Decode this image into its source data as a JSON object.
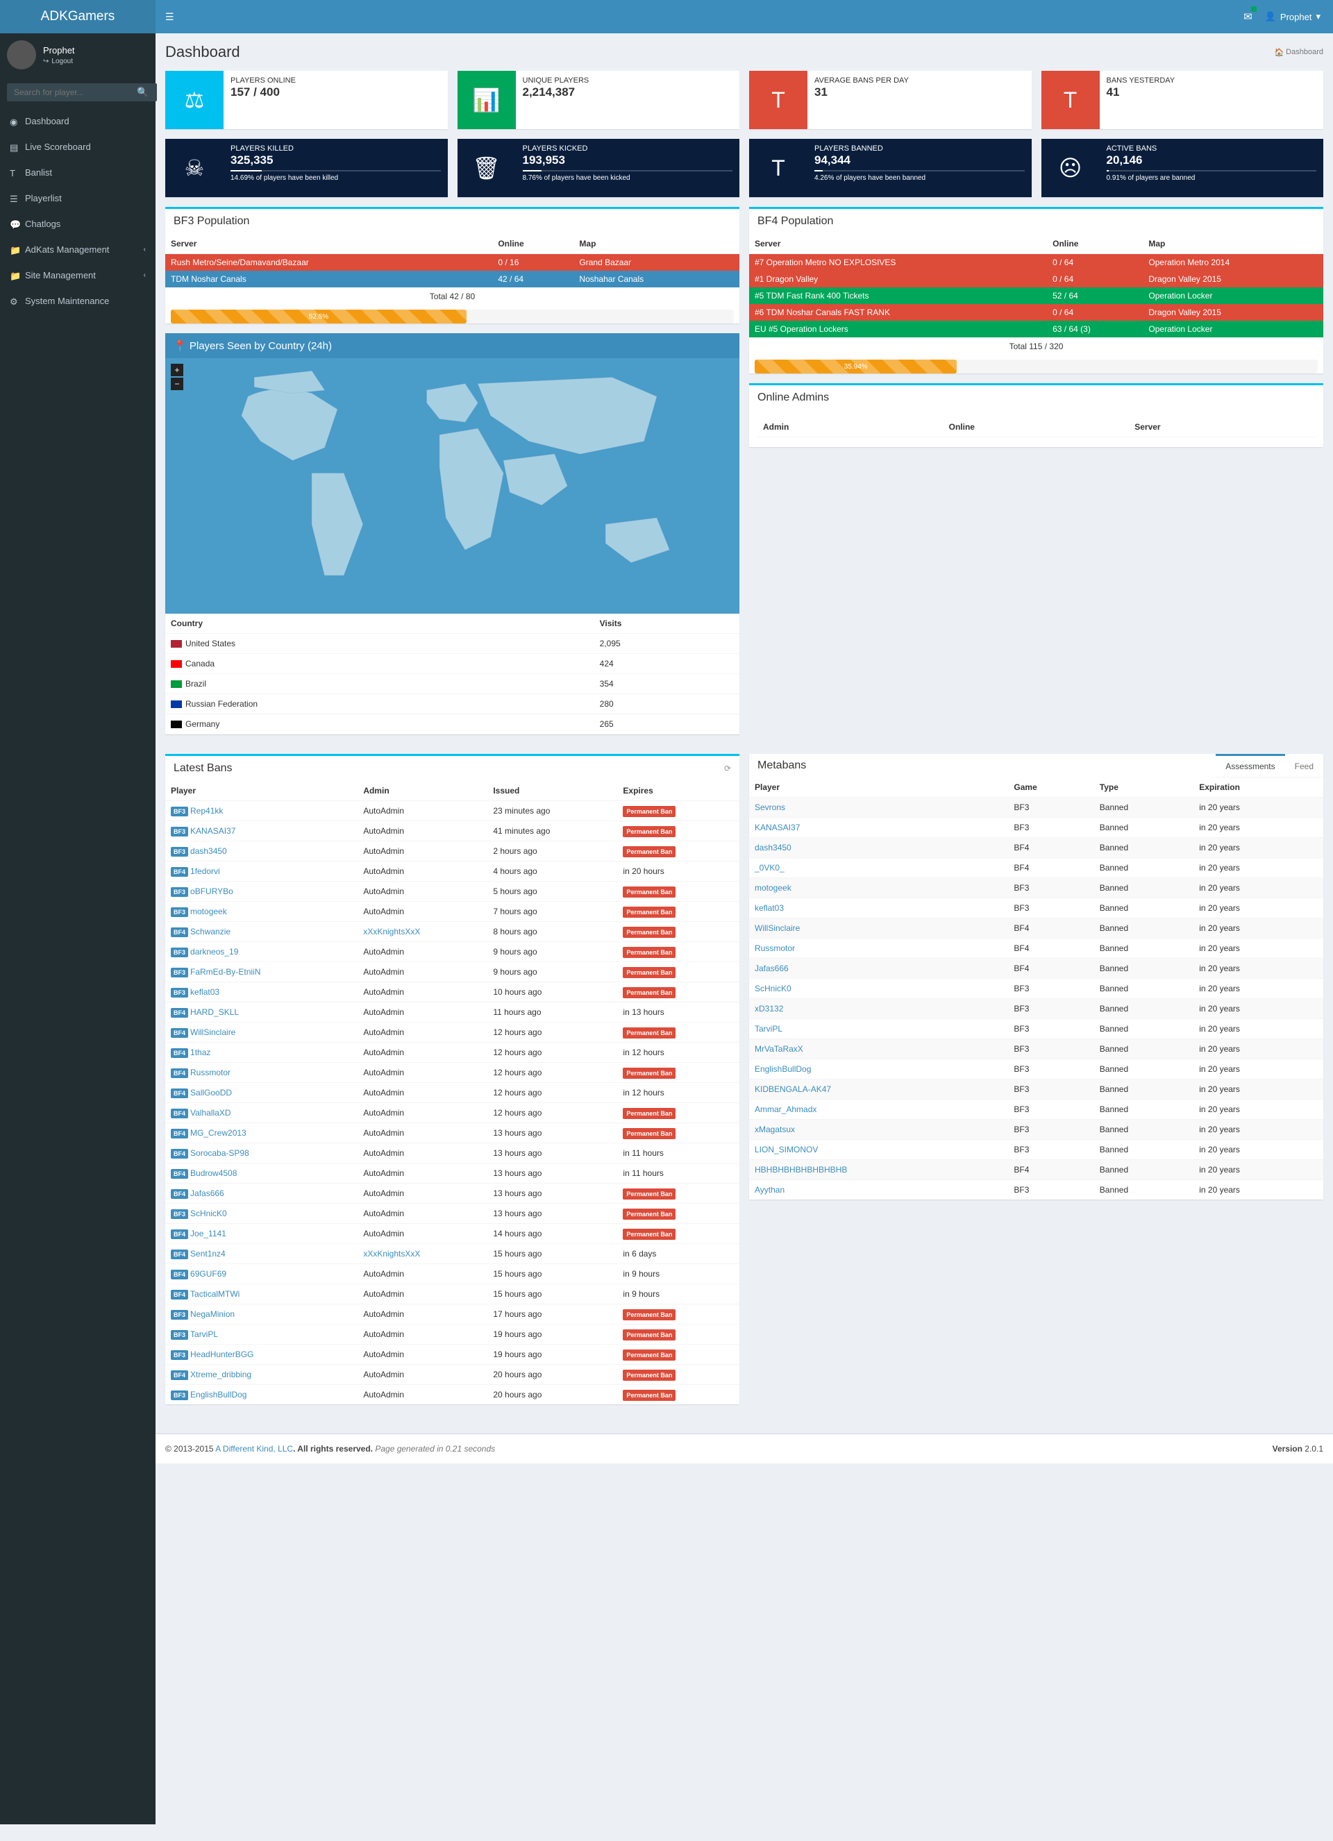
{
  "brand": "ADKGamers",
  "user": {
    "name": "Prophet",
    "logout": "Logout"
  },
  "search_placeholder": "Search for player...",
  "sidebar": [
    {
      "icon": "dashboard",
      "label": "Dashboard"
    },
    {
      "icon": "scoreboard",
      "label": "Live Scoreboard"
    },
    {
      "icon": "banlist",
      "label": "Banlist"
    },
    {
      "icon": "playerlist",
      "label": "Playerlist"
    },
    {
      "icon": "chat",
      "label": "Chatlogs"
    },
    {
      "icon": "folder",
      "label": "AdKats Management",
      "sub": true
    },
    {
      "icon": "folder",
      "label": "Site Management",
      "sub": true
    },
    {
      "icon": "cogs",
      "label": "System Maintenance"
    }
  ],
  "page_title": "Dashboard",
  "breadcrumb": "Dashboard",
  "stats_top": [
    {
      "bg": "aqua",
      "title": "PLAYERS ONLINE",
      "value": "157 / 400"
    },
    {
      "bg": "green",
      "title": "UNIQUE PLAYERS",
      "value": "2,214,387"
    },
    {
      "bg": "red",
      "title": "AVERAGE BANS PER DAY",
      "value": "31"
    },
    {
      "bg": "red",
      "title": "BANS YESTERDAY",
      "value": "41"
    }
  ],
  "stats_dark": [
    {
      "title": "PLAYERS KILLED",
      "value": "325,335",
      "desc": "14.69% of players have been killed",
      "pct": 15
    },
    {
      "title": "PLAYERS KICKED",
      "value": "193,953",
      "desc": "8.76% of players have been kicked",
      "pct": 9
    },
    {
      "title": "PLAYERS BANNED",
      "value": "94,344",
      "desc": "4.26% of players have been banned",
      "pct": 4
    },
    {
      "title": "ACTIVE BANS",
      "value": "20,146",
      "desc": "0.91% of players are banned",
      "pct": 1
    }
  ],
  "bf3": {
    "title": "BF3 Population",
    "headers": [
      "Server",
      "Online",
      "Map"
    ],
    "rows": [
      {
        "c": "red",
        "name": "Rush Metro/Seine/Damavand/Bazaar",
        "online": "0 / 16",
        "map": "Grand Bazaar"
      },
      {
        "c": "blue",
        "name": "TDM Noshar Canals",
        "online": "42 / 64",
        "map": "Noshahar Canals"
      }
    ],
    "total": "Total   42 / 80",
    "bar_pct": 52.5,
    "bar_label": "52.5%"
  },
  "bf4": {
    "title": "BF4 Population",
    "headers": [
      "Server",
      "Online",
      "Map"
    ],
    "rows": [
      {
        "c": "red",
        "name": "#7 Operation Metro NO EXPLOSIVES",
        "online": "0 / 64",
        "map": "Operation Metro 2014"
      },
      {
        "c": "red",
        "name": "#1 Dragon Valley",
        "online": "0 / 64",
        "map": "Dragon Valley 2015"
      },
      {
        "c": "green",
        "name": "#5 TDM Fast Rank 400 Tickets",
        "online": "52 / 64",
        "map": "Operation Locker"
      },
      {
        "c": "red",
        "name": "#6 TDM Noshar Canals FAST RANK",
        "online": "0 / 64",
        "map": "Dragon Valley 2015"
      },
      {
        "c": "green",
        "name": "EU #5 Operation Lockers",
        "online": "63 / 64 (3)",
        "map": "Operation Locker"
      }
    ],
    "total": "Total   115 / 320",
    "bar_pct": 35.94,
    "bar_label": "35.94%"
  },
  "map_title": "Players Seen by Country (24h)",
  "country_headers": [
    "Country",
    "Visits"
  ],
  "countries": [
    {
      "flag": "#b22234",
      "name": "United States",
      "visits": "2,095"
    },
    {
      "flag": "#ff0000",
      "name": "Canada",
      "visits": "424"
    },
    {
      "flag": "#009b3a",
      "name": "Brazil",
      "visits": "354"
    },
    {
      "flag": "#0039a6",
      "name": "Russian Federation",
      "visits": "280"
    },
    {
      "flag": "#000000",
      "name": "Germany",
      "visits": "265"
    }
  ],
  "online_admins": {
    "title": "Online Admins",
    "headers": [
      "Admin",
      "Online",
      "Server"
    ]
  },
  "latest_bans": {
    "title": "Latest Bans",
    "headers": [
      "Player",
      "Admin",
      "Issued",
      "Expires"
    ],
    "perm_label": "Permanent Ban",
    "rows": [
      {
        "g": "BF3",
        "player": "Rep41kk",
        "admin": "AutoAdmin",
        "issued": "23 minutes ago",
        "expires": "perm"
      },
      {
        "g": "BF3",
        "player": "KANASAI37",
        "admin": "AutoAdmin",
        "issued": "41 minutes ago",
        "expires": "perm"
      },
      {
        "g": "BF3",
        "player": "dash3450",
        "admin": "AutoAdmin",
        "issued": "2 hours ago",
        "expires": "perm"
      },
      {
        "g": "BF4",
        "player": "1fedorvi",
        "admin": "AutoAdmin",
        "issued": "4 hours ago",
        "expires": "in 20 hours"
      },
      {
        "g": "BF3",
        "player": "oBFURYBo",
        "admin": "AutoAdmin",
        "issued": "5 hours ago",
        "expires": "perm"
      },
      {
        "g": "BF3",
        "player": "motogeek",
        "admin": "AutoAdmin",
        "issued": "7 hours ago",
        "expires": "perm"
      },
      {
        "g": "BF4",
        "player": "Schwanzie",
        "admin": "xXxKnightsXxX",
        "admin_link": true,
        "issued": "8 hours ago",
        "expires": "perm"
      },
      {
        "g": "BF3",
        "player": "darkneos_19",
        "admin": "AutoAdmin",
        "issued": "9 hours ago",
        "expires": "perm"
      },
      {
        "g": "BF3",
        "player": "FaRmEd-By-EtniiN",
        "admin": "AutoAdmin",
        "issued": "9 hours ago",
        "expires": "perm"
      },
      {
        "g": "BF3",
        "player": "keflat03",
        "admin": "AutoAdmin",
        "issued": "10 hours ago",
        "expires": "perm"
      },
      {
        "g": "BF4",
        "player": "HARD_SKLL",
        "admin": "AutoAdmin",
        "issued": "11 hours ago",
        "expires": "in 13 hours"
      },
      {
        "g": "BF4",
        "player": "WillSinclaire",
        "admin": "AutoAdmin",
        "issued": "12 hours ago",
        "expires": "perm"
      },
      {
        "g": "BF4",
        "player": "1thaz",
        "admin": "AutoAdmin",
        "issued": "12 hours ago",
        "expires": "in 12 hours"
      },
      {
        "g": "BF4",
        "player": "Russmotor",
        "admin": "AutoAdmin",
        "issued": "12 hours ago",
        "expires": "perm"
      },
      {
        "g": "BF4",
        "player": "SallGooDD",
        "admin": "AutoAdmin",
        "issued": "12 hours ago",
        "expires": "in 12 hours"
      },
      {
        "g": "BF4",
        "player": "ValhallaXD",
        "admin": "AutoAdmin",
        "issued": "12 hours ago",
        "expires": "perm"
      },
      {
        "g": "BF4",
        "player": "MG_Crew2013",
        "admin": "AutoAdmin",
        "issued": "13 hours ago",
        "expires": "perm"
      },
      {
        "g": "BF4",
        "player": "Sorocaba-SP98",
        "admin": "AutoAdmin",
        "issued": "13 hours ago",
        "expires": "in 11 hours"
      },
      {
        "g": "BF4",
        "player": "Budrow4508",
        "admin": "AutoAdmin",
        "issued": "13 hours ago",
        "expires": "in 11 hours"
      },
      {
        "g": "BF4",
        "player": "Jafas666",
        "admin": "AutoAdmin",
        "issued": "13 hours ago",
        "expires": "perm"
      },
      {
        "g": "BF3",
        "player": "ScHnicK0",
        "admin": "AutoAdmin",
        "issued": "13 hours ago",
        "expires": "perm"
      },
      {
        "g": "BF4",
        "player": "Joe_1141",
        "admin": "AutoAdmin",
        "issued": "14 hours ago",
        "expires": "perm"
      },
      {
        "g": "BF4",
        "player": "Sent1nz4",
        "admin": "xXxKnightsXxX",
        "admin_link": true,
        "issued": "15 hours ago",
        "expires": "in 6 days"
      },
      {
        "g": "BF4",
        "player": "69GUF69",
        "admin": "AutoAdmin",
        "issued": "15 hours ago",
        "expires": "in 9 hours"
      },
      {
        "g": "BF4",
        "player": "TacticalMTWi",
        "admin": "AutoAdmin",
        "issued": "15 hours ago",
        "expires": "in 9 hours"
      },
      {
        "g": "BF3",
        "player": "NegaMinion",
        "admin": "AutoAdmin",
        "issued": "17 hours ago",
        "expires": "perm"
      },
      {
        "g": "BF3",
        "player": "TarviPL",
        "admin": "AutoAdmin",
        "issued": "19 hours ago",
        "expires": "perm"
      },
      {
        "g": "BF3",
        "player": "HeadHunterBGG",
        "admin": "AutoAdmin",
        "issued": "19 hours ago",
        "expires": "perm"
      },
      {
        "g": "BF4",
        "player": "Xtreme_dribbing",
        "admin": "AutoAdmin",
        "issued": "20 hours ago",
        "expires": "perm"
      },
      {
        "g": "BF3",
        "player": "EnglishBullDog",
        "admin": "AutoAdmin",
        "issued": "20 hours ago",
        "expires": "perm"
      }
    ]
  },
  "metabans": {
    "title": "Metabans",
    "tabs": [
      "Assessments",
      "Feed"
    ],
    "headers": [
      "Player",
      "Game",
      "Type",
      "Expiration"
    ],
    "rows": [
      {
        "player": "Sevrons",
        "game": "BF3",
        "type": "Banned",
        "exp": "in 20 years"
      },
      {
        "player": "KANASAI37",
        "game": "BF3",
        "type": "Banned",
        "exp": "in 20 years"
      },
      {
        "player": "dash3450",
        "game": "BF4",
        "type": "Banned",
        "exp": "in 20 years"
      },
      {
        "player": "_0VK0_",
        "game": "BF4",
        "type": "Banned",
        "exp": "in 20 years"
      },
      {
        "player": "motogeek",
        "game": "BF3",
        "type": "Banned",
        "exp": "in 20 years"
      },
      {
        "player": "keflat03",
        "game": "BF3",
        "type": "Banned",
        "exp": "in 20 years"
      },
      {
        "player": "WillSinclaire",
        "game": "BF4",
        "type": "Banned",
        "exp": "in 20 years"
      },
      {
        "player": "Russmotor",
        "game": "BF4",
        "type": "Banned",
        "exp": "in 20 years"
      },
      {
        "player": "Jafas666",
        "game": "BF4",
        "type": "Banned",
        "exp": "in 20 years"
      },
      {
        "player": "ScHnicK0",
        "game": "BF3",
        "type": "Banned",
        "exp": "in 20 years"
      },
      {
        "player": "xD3132",
        "game": "BF3",
        "type": "Banned",
        "exp": "in 20 years"
      },
      {
        "player": "TarviPL",
        "game": "BF3",
        "type": "Banned",
        "exp": "in 20 years"
      },
      {
        "player": "MrVaTaRaxX",
        "game": "BF3",
        "type": "Banned",
        "exp": "in 20 years"
      },
      {
        "player": "EnglishBullDog",
        "game": "BF3",
        "type": "Banned",
        "exp": "in 20 years"
      },
      {
        "player": "KIDBENGALA-AK47",
        "game": "BF3",
        "type": "Banned",
        "exp": "in 20 years"
      },
      {
        "player": "Ammar_Ahmadx",
        "game": "BF3",
        "type": "Banned",
        "exp": "in 20 years"
      },
      {
        "player": "xMagatsux",
        "game": "BF3",
        "type": "Banned",
        "exp": "in 20 years"
      },
      {
        "player": "LION_SIMONOV",
        "game": "BF3",
        "type": "Banned",
        "exp": "in 20 years"
      },
      {
        "player": "HBHBHBHBHBHBHBHB",
        "game": "BF4",
        "type": "Banned",
        "exp": "in 20 years"
      },
      {
        "player": "Ayythan",
        "game": "BF3",
        "type": "Banned",
        "exp": "in 20 years"
      }
    ]
  },
  "footer": {
    "copyright": "© 2013-2015 ",
    "link": "A Different Kind, LLC",
    "rights": ". All rights reserved. ",
    "gen": "Page generated in 0.21 seconds",
    "version_label": "Version ",
    "version": "2.0.1"
  }
}
